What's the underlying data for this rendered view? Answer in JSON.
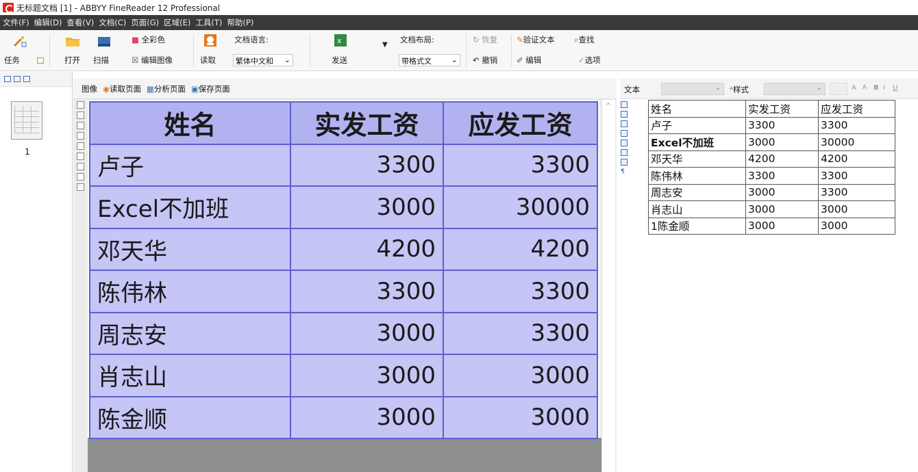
{
  "window": {
    "title": "无标题文档 [1] - ABBYY FineReader 12 Professional"
  },
  "menu": [
    "文件(F)",
    "编辑(D)",
    "查看(V)",
    "文档(C)",
    "页面(G)",
    "区域(E)",
    "工具(T)",
    "帮助(P)"
  ],
  "toolbar": {
    "task_label": "任务",
    "open_label": "打开",
    "scan_label": "扫描",
    "full_color_label": "全彩色",
    "edit_image_label": "编辑图像",
    "read_label": "读取",
    "doc_language_label": "文档语言:",
    "doc_language_value": "繁体中文和",
    "send_label": "发送",
    "doc_layout_label": "文档布局:",
    "doc_layout_value": "带格式文",
    "redo_label": "恢复",
    "undo_label": "撤销",
    "verify_text_label": "验证文本",
    "find_label": "查找",
    "edit_label": "编辑",
    "options_label": "选项"
  },
  "pages_panel": {
    "page_number": "1"
  },
  "image_pane": {
    "title": "图像",
    "read_page": "读取页面",
    "analyze_page": "分析页面",
    "save_page": "保存页面"
  },
  "text_pane": {
    "title": "文本",
    "style_label": "样式"
  },
  "table": {
    "headers": [
      "姓名",
      "实发工资",
      "应发工资"
    ],
    "rows": [
      [
        "卢子",
        "3300",
        "3300"
      ],
      [
        "Excel不加班",
        "3000",
        "30000"
      ],
      [
        "邓天华",
        "4200",
        "4200"
      ],
      [
        "陈伟林",
        "3300",
        "3300"
      ],
      [
        "周志安",
        "3000",
        "3300"
      ],
      [
        "肖志山",
        "3000",
        "3000"
      ],
      [
        "陈金顺",
        "3000",
        "3000"
      ]
    ]
  },
  "text_table": {
    "headers": [
      "姓名",
      "实发工资",
      "应发工资"
    ],
    "rows": [
      [
        "卢子",
        "3300",
        "3300"
      ],
      [
        "Excel不加班",
        "3000",
        "30000"
      ],
      [
        "邓天华",
        "4200",
        "4200"
      ],
      [
        "陈伟林",
        "3300",
        "3300"
      ],
      [
        "周志安",
        "3000",
        "3300"
      ],
      [
        "肖志山",
        "3000",
        "3000"
      ],
      [
        "1陈金顺",
        "3000",
        "3000"
      ]
    ]
  },
  "colors": {
    "menubar": "#3a3a3a",
    "table_fill": "#c5c5f6",
    "table_border": "#5e5ed0",
    "highlight": "#bdecef"
  }
}
